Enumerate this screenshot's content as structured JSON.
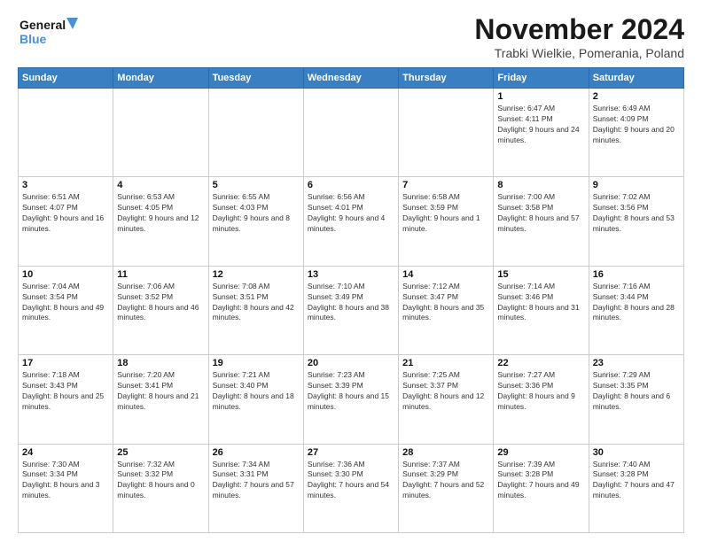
{
  "header": {
    "logo_line1": "General",
    "logo_line2": "Blue",
    "month": "November 2024",
    "location": "Trabki Wielkie, Pomerania, Poland"
  },
  "days_of_week": [
    "Sunday",
    "Monday",
    "Tuesday",
    "Wednesday",
    "Thursday",
    "Friday",
    "Saturday"
  ],
  "weeks": [
    [
      {
        "day": "",
        "info": ""
      },
      {
        "day": "",
        "info": ""
      },
      {
        "day": "",
        "info": ""
      },
      {
        "day": "",
        "info": ""
      },
      {
        "day": "",
        "info": ""
      },
      {
        "day": "1",
        "info": "Sunrise: 6:47 AM\nSunset: 4:11 PM\nDaylight: 9 hours and 24 minutes."
      },
      {
        "day": "2",
        "info": "Sunrise: 6:49 AM\nSunset: 4:09 PM\nDaylight: 9 hours and 20 minutes."
      }
    ],
    [
      {
        "day": "3",
        "info": "Sunrise: 6:51 AM\nSunset: 4:07 PM\nDaylight: 9 hours and 16 minutes."
      },
      {
        "day": "4",
        "info": "Sunrise: 6:53 AM\nSunset: 4:05 PM\nDaylight: 9 hours and 12 minutes."
      },
      {
        "day": "5",
        "info": "Sunrise: 6:55 AM\nSunset: 4:03 PM\nDaylight: 9 hours and 8 minutes."
      },
      {
        "day": "6",
        "info": "Sunrise: 6:56 AM\nSunset: 4:01 PM\nDaylight: 9 hours and 4 minutes."
      },
      {
        "day": "7",
        "info": "Sunrise: 6:58 AM\nSunset: 3:59 PM\nDaylight: 9 hours and 1 minute."
      },
      {
        "day": "8",
        "info": "Sunrise: 7:00 AM\nSunset: 3:58 PM\nDaylight: 8 hours and 57 minutes."
      },
      {
        "day": "9",
        "info": "Sunrise: 7:02 AM\nSunset: 3:56 PM\nDaylight: 8 hours and 53 minutes."
      }
    ],
    [
      {
        "day": "10",
        "info": "Sunrise: 7:04 AM\nSunset: 3:54 PM\nDaylight: 8 hours and 49 minutes."
      },
      {
        "day": "11",
        "info": "Sunrise: 7:06 AM\nSunset: 3:52 PM\nDaylight: 8 hours and 46 minutes."
      },
      {
        "day": "12",
        "info": "Sunrise: 7:08 AM\nSunset: 3:51 PM\nDaylight: 8 hours and 42 minutes."
      },
      {
        "day": "13",
        "info": "Sunrise: 7:10 AM\nSunset: 3:49 PM\nDaylight: 8 hours and 38 minutes."
      },
      {
        "day": "14",
        "info": "Sunrise: 7:12 AM\nSunset: 3:47 PM\nDaylight: 8 hours and 35 minutes."
      },
      {
        "day": "15",
        "info": "Sunrise: 7:14 AM\nSunset: 3:46 PM\nDaylight: 8 hours and 31 minutes."
      },
      {
        "day": "16",
        "info": "Sunrise: 7:16 AM\nSunset: 3:44 PM\nDaylight: 8 hours and 28 minutes."
      }
    ],
    [
      {
        "day": "17",
        "info": "Sunrise: 7:18 AM\nSunset: 3:43 PM\nDaylight: 8 hours and 25 minutes."
      },
      {
        "day": "18",
        "info": "Sunrise: 7:20 AM\nSunset: 3:41 PM\nDaylight: 8 hours and 21 minutes."
      },
      {
        "day": "19",
        "info": "Sunrise: 7:21 AM\nSunset: 3:40 PM\nDaylight: 8 hours and 18 minutes."
      },
      {
        "day": "20",
        "info": "Sunrise: 7:23 AM\nSunset: 3:39 PM\nDaylight: 8 hours and 15 minutes."
      },
      {
        "day": "21",
        "info": "Sunrise: 7:25 AM\nSunset: 3:37 PM\nDaylight: 8 hours and 12 minutes."
      },
      {
        "day": "22",
        "info": "Sunrise: 7:27 AM\nSunset: 3:36 PM\nDaylight: 8 hours and 9 minutes."
      },
      {
        "day": "23",
        "info": "Sunrise: 7:29 AM\nSunset: 3:35 PM\nDaylight: 8 hours and 6 minutes."
      }
    ],
    [
      {
        "day": "24",
        "info": "Sunrise: 7:30 AM\nSunset: 3:34 PM\nDaylight: 8 hours and 3 minutes."
      },
      {
        "day": "25",
        "info": "Sunrise: 7:32 AM\nSunset: 3:32 PM\nDaylight: 8 hours and 0 minutes."
      },
      {
        "day": "26",
        "info": "Sunrise: 7:34 AM\nSunset: 3:31 PM\nDaylight: 7 hours and 57 minutes."
      },
      {
        "day": "27",
        "info": "Sunrise: 7:36 AM\nSunset: 3:30 PM\nDaylight: 7 hours and 54 minutes."
      },
      {
        "day": "28",
        "info": "Sunrise: 7:37 AM\nSunset: 3:29 PM\nDaylight: 7 hours and 52 minutes."
      },
      {
        "day": "29",
        "info": "Sunrise: 7:39 AM\nSunset: 3:28 PM\nDaylight: 7 hours and 49 minutes."
      },
      {
        "day": "30",
        "info": "Sunrise: 7:40 AM\nSunset: 3:28 PM\nDaylight: 7 hours and 47 minutes."
      }
    ]
  ]
}
